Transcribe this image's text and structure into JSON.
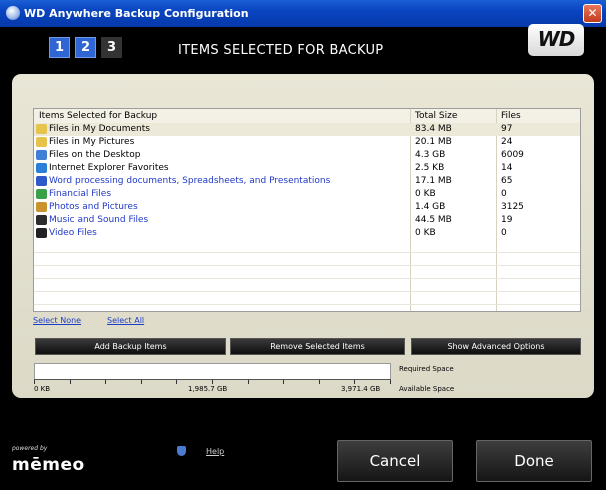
{
  "window": {
    "title": "WD Anywhere Backup Configuration",
    "close_glyph": "✕",
    "icon": "wd-app-icon"
  },
  "steps": [
    "1",
    "2",
    "3"
  ],
  "active_steps": 2,
  "section_title": "ITEMS SELECTED FOR BACKUP",
  "logo": "WD",
  "table": {
    "headers": {
      "name": "Items Selected for Backup",
      "size": "Total Size",
      "files": "Files"
    },
    "rows": [
      {
        "name": "Files in My Documents",
        "size": "83.4 MB",
        "files": "97",
        "icon": "folder-documents-icon",
        "color": "#000000"
      },
      {
        "name": "Files in My Pictures",
        "size": "20.1 MB",
        "files": "24",
        "icon": "folder-pictures-icon",
        "color": "#000000"
      },
      {
        "name": "Files on the Desktop",
        "size": "4.3 GB",
        "files": "6009",
        "icon": "desktop-icon",
        "color": "#000000"
      },
      {
        "name": "Internet Explorer Favorites",
        "size": "2.5 KB",
        "files": "14",
        "icon": "internet-explorer-icon",
        "color": "#000000"
      },
      {
        "name": "Word processing documents, Spreadsheets, and Presentations",
        "size": "17.1 MB",
        "files": "65",
        "icon": "document-icon",
        "color": "#1f39c7"
      },
      {
        "name": "Financial Files",
        "size": "0 KB",
        "files": "0",
        "icon": "money-icon",
        "color": "#1f39c7"
      },
      {
        "name": "Photos and Pictures",
        "size": "1.4 GB",
        "files": "3125",
        "icon": "photo-icon",
        "color": "#1f39c7"
      },
      {
        "name": "Music and Sound Files",
        "size": "44.5 MB",
        "files": "19",
        "icon": "music-icon",
        "color": "#1f39c7"
      },
      {
        "name": "Video Files",
        "size": "0 KB",
        "files": "0",
        "icon": "video-icon",
        "color": "#1f39c7"
      }
    ]
  },
  "links": {
    "select_none": "Select None",
    "select_all": "Select All"
  },
  "buttons": {
    "add": "Add Backup Items",
    "remove": "Remove Selected Items",
    "advanced": "Show Advanced Options"
  },
  "gauge": {
    "min": "0 KB",
    "mid": "1,985.7 GB",
    "max": "3,971.4 GB",
    "required_label": "Required Space",
    "available_label": "Available Space",
    "fill_fraction": 0.0
  },
  "footer": {
    "powered_by": "powered by",
    "brand": "mēmeo",
    "help": "Help",
    "cancel": "Cancel",
    "done": "Done"
  },
  "colors": {
    "accent": "#2f66d4",
    "link": "#1b3fc8",
    "titlebar": "#0a44c0"
  }
}
